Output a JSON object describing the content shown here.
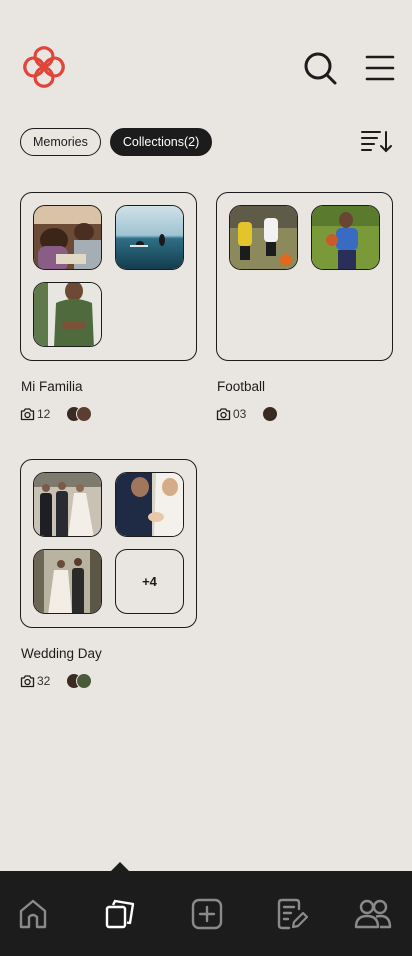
{
  "header": {
    "logo_icon": "flower-logo",
    "brand_color": "#e0453a",
    "search_icon": "search-icon",
    "menu_icon": "hamburger-menu-icon"
  },
  "filters": {
    "tabs": [
      {
        "label": "Memories",
        "active": false
      },
      {
        "label": "Collections(2)",
        "active": true
      }
    ],
    "sort_icon": "sort-descending-icon"
  },
  "collections": [
    {
      "title": "Mi Familia",
      "photo_count": "12",
      "thumbnails": [
        "family-dinner-photo",
        "surfers-ocean-photo",
        "woman-green-shirt-photo"
      ],
      "more_label": ""
    },
    {
      "title": "Football",
      "photo_count": "03",
      "thumbnails": [
        "kids-soccer-match-photo",
        "boy-with-ball-photo"
      ],
      "more_label": ""
    },
    {
      "title": "Wedding Day",
      "photo_count": "32",
      "thumbnails": [
        "wedding-party-photo",
        "couple-rings-photo",
        "couple-forest-photo"
      ],
      "more_label": "+4"
    }
  ],
  "bottom_nav": {
    "items": [
      {
        "icon": "home-icon",
        "active": false
      },
      {
        "icon": "collections-icon",
        "active": true
      },
      {
        "icon": "add-square-icon",
        "active": false
      },
      {
        "icon": "edit-note-icon",
        "active": false
      },
      {
        "icon": "people-icon",
        "active": false
      }
    ]
  },
  "colors": {
    "background": "#e9e5e0",
    "text": "#1c1c1c",
    "nav_bar": "#1c1c1c",
    "nav_icon_inactive": "#8a8a8a",
    "nav_icon_active": "#ffffff"
  }
}
